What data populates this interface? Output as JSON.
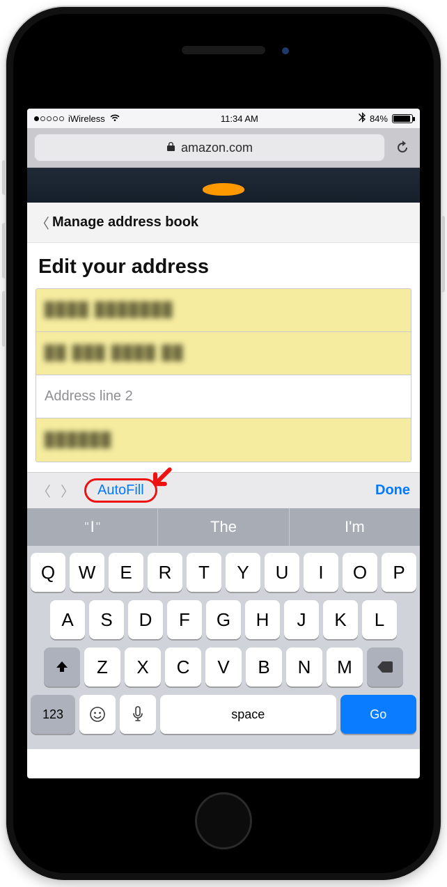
{
  "status": {
    "carrier": "iWireless",
    "time": "11:34 AM",
    "battery_pct": "84%"
  },
  "browser": {
    "domain": "amazon.com"
  },
  "page": {
    "breadcrumb": "Manage address book",
    "heading": "Edit your address",
    "fields": {
      "name": "████ ███████",
      "addr1": "██ ███ ████ ██",
      "addr2_placeholder": "Address line 2",
      "city": "██████"
    }
  },
  "toolbar": {
    "autofill": "AutoFill",
    "done": "Done"
  },
  "predictive": {
    "a": "I",
    "b": "The",
    "c": "I'm"
  },
  "keys": {
    "r1": [
      "Q",
      "W",
      "E",
      "R",
      "T",
      "Y",
      "U",
      "I",
      "O",
      "P"
    ],
    "r2": [
      "A",
      "S",
      "D",
      "F",
      "G",
      "H",
      "J",
      "K",
      "L"
    ],
    "r3": [
      "Z",
      "X",
      "C",
      "V",
      "B",
      "N",
      "M"
    ],
    "k123": "123",
    "space": "space",
    "go": "Go"
  }
}
